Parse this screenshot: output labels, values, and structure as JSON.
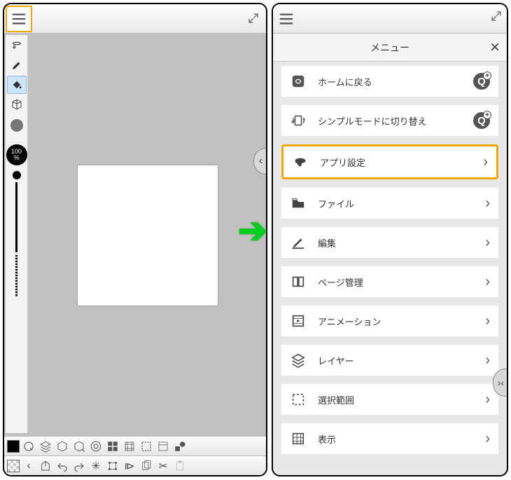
{
  "left": {
    "opacity_value": "100",
    "opacity_unit": "%"
  },
  "menu": {
    "title": "メニュー",
    "items": [
      {
        "label": "ホームに戻る",
        "icon": "home",
        "action": "add"
      },
      {
        "label": "シンプルモードに切り替え",
        "icon": "rotate",
        "action": "add"
      },
      {
        "label": "アプリ設定",
        "icon": "q-logo",
        "action": "chevron",
        "highlight": true
      },
      {
        "label": "ファイル",
        "icon": "folder",
        "action": "chevron"
      },
      {
        "label": "編集",
        "icon": "pencil",
        "action": "chevron"
      },
      {
        "label": "ページ管理",
        "icon": "book",
        "action": "chevron"
      },
      {
        "label": "アニメーション",
        "icon": "film",
        "action": "chevron"
      },
      {
        "label": "レイヤー",
        "icon": "layers",
        "action": "chevron"
      },
      {
        "label": "選択範囲",
        "icon": "marquee",
        "action": "chevron"
      },
      {
        "label": "表示",
        "icon": "grid",
        "action": "chevron"
      }
    ]
  }
}
